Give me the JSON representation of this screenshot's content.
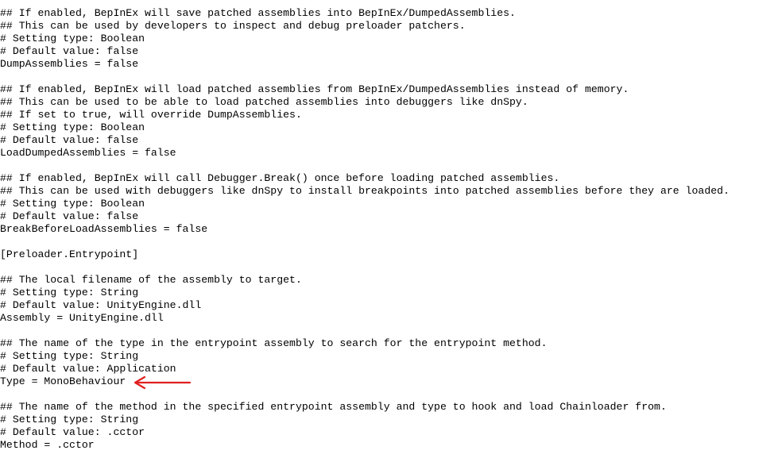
{
  "config": {
    "lines": [
      "## If enabled, BepInEx will save patched assemblies into BepInEx/DumpedAssemblies.",
      "## This can be used by developers to inspect and debug preloader patchers.",
      "# Setting type: Boolean",
      "# Default value: false",
      "DumpAssemblies = false",
      "",
      "## If enabled, BepInEx will load patched assemblies from BepInEx/DumpedAssemblies instead of memory.",
      "## This can be used to be able to load patched assemblies into debuggers like dnSpy.",
      "## If set to true, will override DumpAssemblies.",
      "# Setting type: Boolean",
      "# Default value: false",
      "LoadDumpedAssemblies = false",
      "",
      "## If enabled, BepInEx will call Debugger.Break() once before loading patched assemblies.",
      "## This can be used with debuggers like dnSpy to install breakpoints into patched assemblies before they are loaded.",
      "# Setting type: Boolean",
      "# Default value: false",
      "BreakBeforeLoadAssemblies = false",
      "",
      "[Preloader.Entrypoint]",
      "",
      "## The local filename of the assembly to target.",
      "# Setting type: String",
      "# Default value: UnityEngine.dll",
      "Assembly = UnityEngine.dll",
      "",
      "## The name of the type in the entrypoint assembly to search for the entrypoint method.",
      "# Setting type: String",
      "# Default value: Application",
      "Type = MonoBehaviour",
      "",
      "## The name of the method in the specified entrypoint assembly and type to hook and load Chainloader from.",
      "# Setting type: String",
      "# Default value: .cctor",
      "Method = .cctor"
    ]
  },
  "annotation": {
    "arrow_color": "#e02020"
  }
}
